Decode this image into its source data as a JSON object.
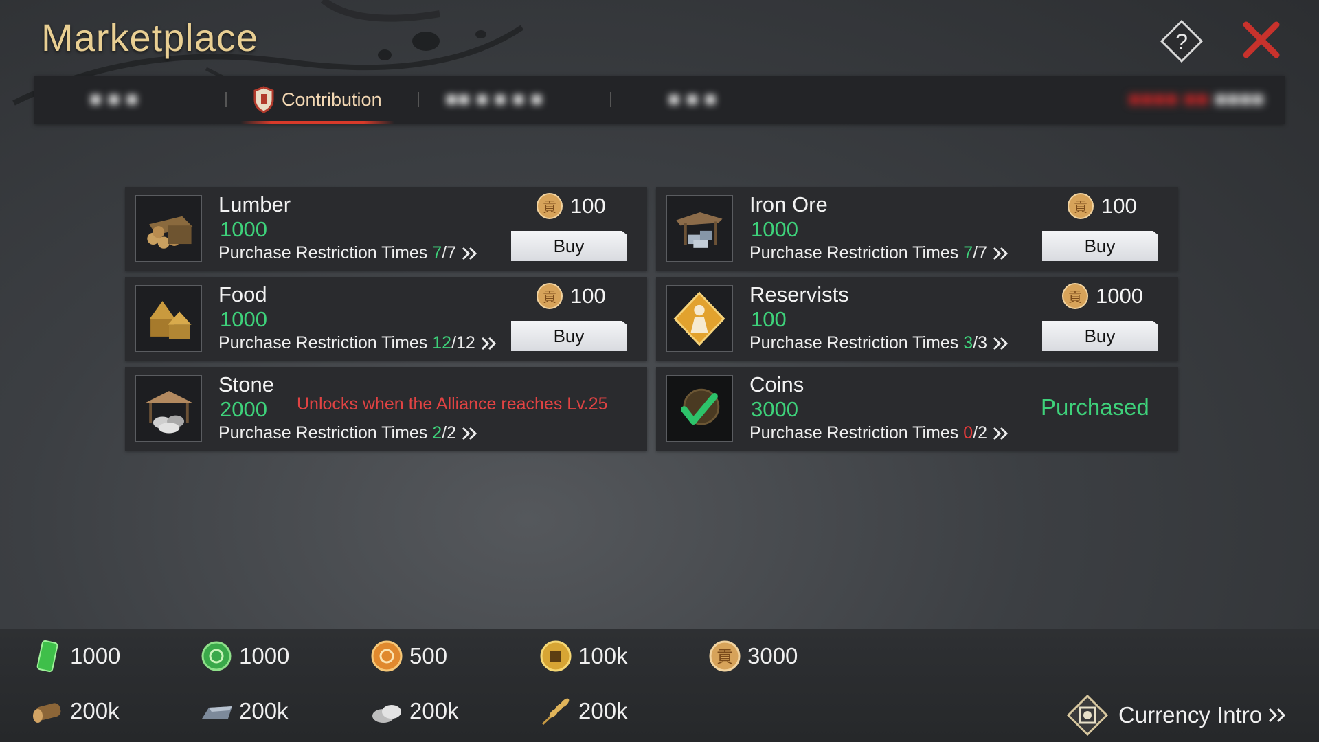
{
  "header": {
    "title": "Marketplace"
  },
  "tabs": [
    {
      "label": "■ ■ ■",
      "blurred": true
    },
    {
      "label": "Contribution",
      "active": true
    },
    {
      "label": "■■ ■ ■ ■ ■",
      "blurred": true
    },
    {
      "label": "■ ■ ■",
      "blurred": true
    }
  ],
  "timer": {
    "red": "■■■■ ■■",
    "white": "■■■■"
  },
  "items": [
    {
      "name": "Lumber",
      "amount": "1000",
      "restriction_label": "Purchase Restriction Times",
      "current": "7",
      "max": "/7",
      "price": "100",
      "action": "Buy",
      "icon": "lumber-icon"
    },
    {
      "name": "Iron Ore",
      "amount": "1000",
      "restriction_label": "Purchase Restriction Times",
      "current": "7",
      "max": "/7",
      "price": "100",
      "action": "Buy",
      "icon": "iron-ore-icon"
    },
    {
      "name": "Food",
      "amount": "1000",
      "restriction_label": "Purchase Restriction Times",
      "current": "12",
      "max": "/12",
      "price": "100",
      "action": "Buy",
      "icon": "food-icon"
    },
    {
      "name": "Reservists",
      "amount": "100",
      "restriction_label": "Purchase Restriction Times",
      "current": "3",
      "max": "/3",
      "price": "1000",
      "action": "Buy",
      "icon": "reservists-icon"
    },
    {
      "name": "Stone",
      "amount": "2000",
      "restriction_label": "Purchase Restriction Times",
      "current": "2",
      "max": "/2",
      "locked_text": "Unlocks  when the Alliance reaches Lv.25",
      "icon": "stone-icon"
    },
    {
      "name": "Coins",
      "amount": "3000",
      "restriction_label": "Purchase Restriction Times",
      "current": "0",
      "max": "/2",
      "status": "Purchased",
      "icon": "coins-check-icon"
    }
  ],
  "currencies": [
    {
      "icon": "jade-token-icon",
      "value": "1000"
    },
    {
      "icon": "green-coin-icon",
      "value": "1000"
    },
    {
      "icon": "orange-coin-icon",
      "value": "500"
    },
    {
      "icon": "gold-square-coin-icon",
      "value": "100k"
    },
    {
      "icon": "contribution-coin-icon",
      "value": "3000"
    },
    {
      "icon": "log-icon",
      "value": "200k"
    },
    {
      "icon": "iron-ingot-icon",
      "value": "200k"
    },
    {
      "icon": "stone-pile-icon",
      "value": "200k"
    },
    {
      "icon": "wheat-icon",
      "value": "200k"
    }
  ],
  "footer": {
    "currency_intro": "Currency Intro"
  },
  "colors": {
    "accent_gold": "#e9cf93",
    "green": "#3ed17a",
    "red": "#e04343",
    "close_red": "#c8322c"
  }
}
